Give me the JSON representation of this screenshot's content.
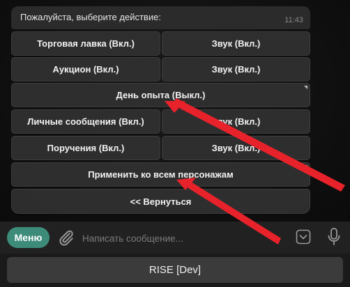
{
  "message": {
    "text": "Пожалуйста, выберите действие:",
    "time": "11:43"
  },
  "keyboard": {
    "rows": [
      [
        "Торговая лавка (Вкл.)",
        "Звук (Вкл.)"
      ],
      [
        "Аукцион (Вкл.)",
        "Звук (Вкл.)"
      ],
      [
        "День опыта (Выкл.)"
      ],
      [
        "Личные сообщения (Вкл.)",
        "Звук (Вкл.)"
      ],
      [
        "Поручения (Вкл.)",
        "Звук (Вкл.)"
      ],
      [
        "Применить ко всем персонажам"
      ],
      [
        "<< Вернуться"
      ]
    ]
  },
  "composer": {
    "menu_label": "Меню",
    "placeholder": "Написать сообщение...",
    "icons": [
      "paperclip-icon",
      "keyboard-icon",
      "microphone-icon"
    ]
  },
  "bottom_button": {
    "label": "RISE [Dev]"
  },
  "colors": {
    "accent": "#3d8c7a",
    "annotation_arrow": "#e8222a",
    "button_bg": "#303030",
    "bubble_bg": "#2b2b2b"
  }
}
